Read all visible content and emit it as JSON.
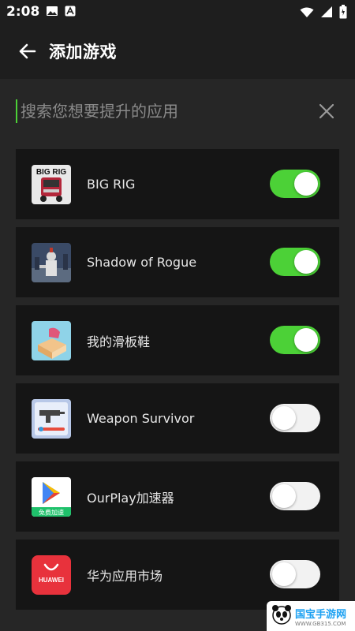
{
  "status": {
    "time": "2:08"
  },
  "header": {
    "title": "添加游戏",
    "back_icon": "arrow-left-icon"
  },
  "search": {
    "placeholder": "搜索您想要提升的应用",
    "value": "",
    "clear_icon": "close-icon"
  },
  "apps": [
    {
      "name": "BIG RIG",
      "enabled": true,
      "icon_text": "BIG RIG"
    },
    {
      "name": "Shadow of Rogue",
      "enabled": true
    },
    {
      "name": "我的滑板鞋",
      "enabled": true
    },
    {
      "name": "Weapon Survivor",
      "enabled": false
    },
    {
      "name": "OurPlay加速器",
      "enabled": false,
      "icon_text": "免费加速"
    },
    {
      "name": "华为应用市场",
      "enabled": false,
      "icon_text": "HUAWEI"
    }
  ],
  "watermark": {
    "text": "国宝手游网",
    "url": "WWW.GB315.COM"
  },
  "colors": {
    "accent": "#4cd137",
    "background": "#262626",
    "card": "#151515"
  }
}
